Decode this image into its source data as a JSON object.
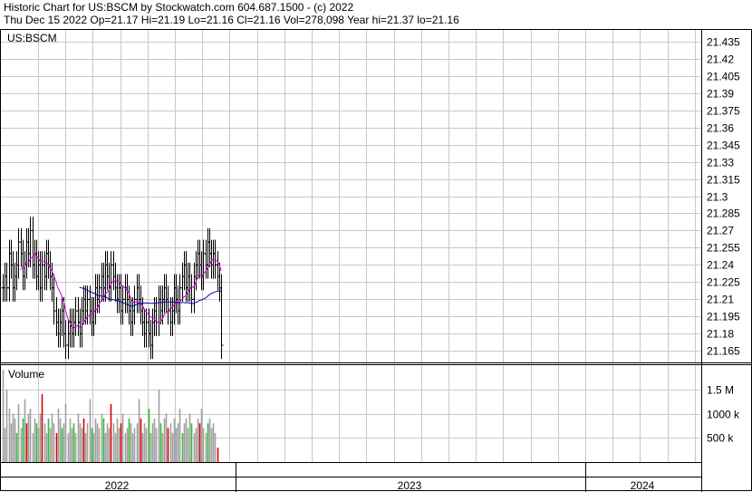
{
  "header": {
    "line1": "Historic Chart for US:BSCM by Stockwatch.com 604.687.1500 - (c) 2022",
    "line2": "Thu Dec 15 2022   Op=21.17   Hi=21.19   Lo=21.16   Cl=21.16   Vol=278,098   Year hi=21.37   lo=21.16"
  },
  "colors": {
    "grid": "#c8c8c8",
    "price_bar": "#000000",
    "ma_short": "#cc00cc",
    "ma_long": "#0000aa",
    "vol_neutral": "#a0a0a0",
    "vol_up": "#33bb33",
    "vol_down": "#dd0000"
  },
  "chart_data": [
    {
      "type": "ohlc",
      "title": "US:BSCM",
      "ylim": [
        21.155,
        21.445
      ],
      "yticks": [
        21.435,
        21.42,
        21.405,
        21.39,
        21.375,
        21.36,
        21.345,
        21.33,
        21.315,
        21.3,
        21.285,
        21.27,
        21.255,
        21.24,
        21.225,
        21.21,
        21.195,
        21.18,
        21.165
      ],
      "x_axis": {
        "labels": [
          "2022",
          "2023",
          "2024"
        ]
      },
      "series": [
        {
          "values": [
            21.22,
            21.23,
            21.22,
            21.25,
            21.24,
            21.22,
            21.23,
            21.24,
            21.26,
            21.25,
            21.23,
            21.24,
            21.26,
            21.25,
            21.27,
            21.24,
            21.25,
            21.23,
            21.24,
            21.22,
            21.24,
            21.23,
            21.25,
            21.24,
            21.23,
            21.22,
            21.2,
            21.19,
            21.18,
            21.19,
            21.2,
            21.18,
            21.17,
            21.18,
            21.19,
            21.18,
            21.19,
            21.2,
            21.19,
            21.18,
            21.2,
            21.21,
            21.2,
            21.21,
            21.2,
            21.19,
            21.2,
            21.22,
            21.21,
            21.22,
            21.23,
            21.22,
            21.24,
            21.23,
            21.22,
            21.24,
            21.23,
            21.22,
            21.21,
            21.22,
            21.2,
            21.21,
            21.22,
            21.21,
            21.2,
            21.19,
            21.2,
            21.21,
            21.22,
            21.21,
            21.2,
            21.19,
            21.18,
            21.19,
            21.18,
            21.17,
            21.19,
            21.2,
            21.19,
            21.21,
            21.2,
            21.21,
            21.22,
            21.21,
            21.2,
            21.19,
            21.2,
            21.22,
            21.21,
            21.2,
            21.22,
            21.23,
            21.24,
            21.22,
            21.23,
            21.22,
            21.21,
            21.23,
            21.24,
            21.25,
            21.24,
            21.23,
            21.25,
            21.24,
            21.26,
            21.25,
            21.24,
            21.25,
            21.24,
            21.23,
            21.22,
            21.17
          ]
        },
        {
          "name": "",
          "values": []
        },
        {
          "name": "",
          "values": []
        }
      ]
    },
    {
      "type": "bar",
      "title": "Volume",
      "ylim": [
        0,
        2000000
      ],
      "yticks": [
        {
          "value": 1500000,
          "label": "1.5 M"
        },
        {
          "value": 1000000,
          "label": "1000 k"
        },
        {
          "value": 500000,
          "label": "500 k"
        }
      ],
      "values": [
        1900000,
        700000,
        1500000,
        1100000,
        800000,
        1000000,
        900000,
        600000,
        1200000,
        700000,
        900000,
        1300000,
        800000,
        1000000,
        1100000,
        600000,
        900000,
        800000,
        700000,
        1000000,
        1400000,
        800000,
        600000,
        900000,
        700000,
        1000000,
        800000,
        600000,
        1100000,
        900000,
        700000,
        800000,
        1200000,
        600000,
        900000,
        700000,
        800000,
        600000,
        1000000,
        800000,
        700000,
        900000,
        600000,
        800000,
        1300000,
        700000,
        600000,
        900000,
        800000,
        700000,
        1000000,
        900000,
        600000,
        800000,
        700000,
        1200000,
        800000,
        600000,
        900000,
        700000,
        800000,
        1000000,
        600000,
        700000,
        900000,
        800000,
        600000,
        700000,
        800000,
        1300000,
        900000,
        600000,
        800000,
        700000,
        1100000,
        600000,
        800000,
        900000,
        700000,
        1500000,
        800000,
        600000,
        900000,
        1000000,
        700000,
        800000,
        600000,
        900000,
        700000,
        800000,
        1100000,
        600000,
        800000,
        900000,
        700000,
        1000000,
        800000,
        600000,
        700000,
        900000,
        800000,
        1100000,
        700000,
        600000,
        800000,
        900000,
        700000,
        800000,
        600000,
        300000
      ],
      "colors": [
        "n",
        "n",
        "n",
        "n",
        "n",
        "n",
        "n",
        "g",
        "n",
        "n",
        "g",
        "n",
        "r",
        "n",
        "n",
        "n",
        "n",
        "g",
        "n",
        "n",
        "r",
        "n",
        "n",
        "g",
        "n",
        "n",
        "n",
        "r",
        "n",
        "n",
        "g",
        "n",
        "n",
        "n",
        "n",
        "n",
        "g",
        "n",
        "n",
        "n",
        "n",
        "r",
        "n",
        "n",
        "n",
        "g",
        "n",
        "n",
        "n",
        "n",
        "n",
        "g",
        "n",
        "n",
        "n",
        "r",
        "n",
        "n",
        "n",
        "n",
        "r",
        "n",
        "n",
        "n",
        "g",
        "n",
        "n",
        "n",
        "n",
        "n",
        "r",
        "n",
        "n",
        "n",
        "g",
        "n",
        "n",
        "n",
        "n",
        "n",
        "g",
        "n",
        "n",
        "n",
        "r",
        "n",
        "n",
        "n",
        "n",
        "n",
        "n",
        "g",
        "n",
        "n",
        "n",
        "n",
        "g",
        "n",
        "n",
        "n",
        "r",
        "n",
        "n",
        "n",
        "g",
        "n",
        "n",
        "n",
        "n",
        "r"
      ]
    }
  ]
}
